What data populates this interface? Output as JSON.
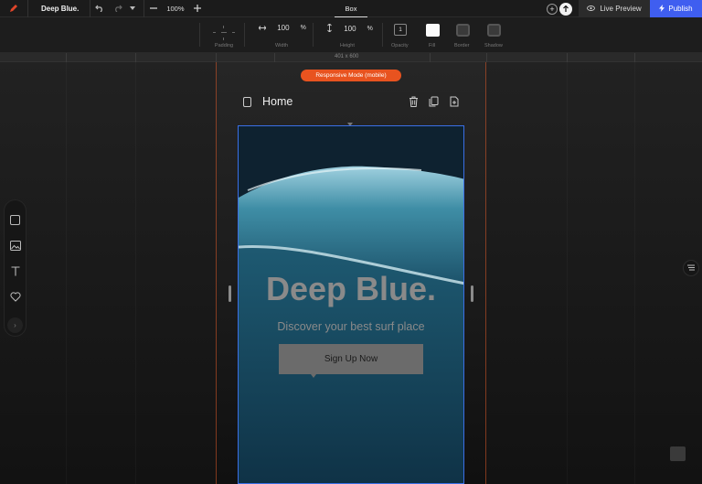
{
  "topbar": {
    "project_title": "Deep Blue.",
    "zoom": "100%",
    "mode_tab": "Box",
    "live_preview": "Live Preview",
    "publish": "Publish",
    "icons": [
      "pencil-logo-icon",
      "undo-icon",
      "redo-icon",
      "history-dropdown-icon",
      "zoom-out-icon",
      "zoom-in-icon",
      "add-icon",
      "upload-icon",
      "eye-icon",
      "bolt-icon"
    ]
  },
  "propbar": {
    "padding_label": "Padding",
    "width_value": "100",
    "width_unit": "%",
    "width_label": "Width",
    "height_value": "100",
    "height_unit": "%",
    "height_label": "Height",
    "opacity_value": "1",
    "opacity_label": "Opacity",
    "fill_label": "Fill",
    "fill_color": "#fafafa",
    "border_label": "Border",
    "shadow_label": "Shadow"
  },
  "canvas": {
    "size_readout": "401 x 600",
    "responsive_badge": "Responsive Mode (mobile)",
    "page_name": "Home",
    "hero_title": "Deep Blue.",
    "hero_subtitle": "Discover your best surf place",
    "cta_label": "Sign Up Now"
  },
  "colors": {
    "accent_orange": "#e8531f",
    "publish_blue": "#3f5ef0",
    "selection_blue": "#3a6fe6"
  },
  "left_tools": [
    "box-tool-icon",
    "image-tool-icon",
    "text-tool-icon",
    "heart-tool-icon",
    "expand-chevron-icon"
  ]
}
